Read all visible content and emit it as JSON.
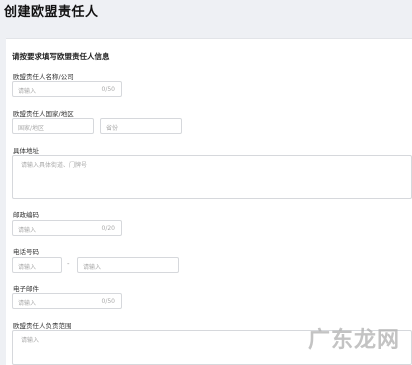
{
  "page_title": "创建欧盟责任人",
  "section_title": "请按要求填写欧盟责任人信息",
  "fields": {
    "name": {
      "label": "欧盟责任人名称/公司",
      "placeholder": "请输入",
      "counter": "0/50"
    },
    "region": {
      "label": "欧盟责任人国家/地区",
      "country_placeholder": "国家/地区",
      "province_placeholder": "省份"
    },
    "address": {
      "label": "具体地址",
      "placeholder": "请输入具体街道、门牌号"
    },
    "postal": {
      "label": "邮政编码",
      "placeholder": "请输入",
      "counter": "0/20"
    },
    "phone": {
      "label": "电话号码",
      "code_placeholder": "请输入",
      "separator": "-",
      "number_placeholder": "请输入"
    },
    "email": {
      "label": "电子邮件",
      "placeholder": "请输入",
      "counter": "0/50"
    },
    "scope": {
      "label": "欧盟责任人负责范围",
      "placeholder": "请输入"
    }
  },
  "watermark": "广东龙网"
}
